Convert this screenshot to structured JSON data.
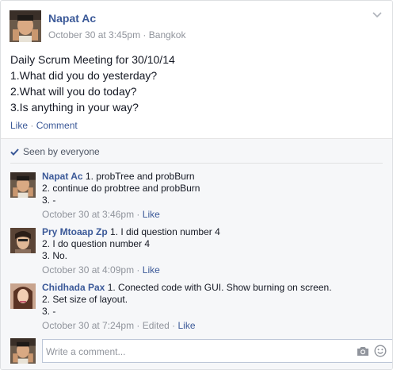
{
  "post": {
    "author": "Napat Ac",
    "date": "October 30 at 3:45pm",
    "separator": "·",
    "location": "Bangkok",
    "lines": [
      "Daily Scrum Meeting for 30/10/14",
      "1.What did you do yesterday?",
      "2.What will you do today?",
      "3.Is anything in your way?"
    ],
    "actions": {
      "like": "Like",
      "comment": "Comment"
    }
  },
  "feedback": {
    "seen": "Seen by everyone",
    "comments": [
      {
        "author": "Napat Ac",
        "first_line": "1. probTree and probBurn",
        "lines": [
          "2. continue do probtree and probBurn",
          "3. -"
        ],
        "time": "October 30 at 3:46pm",
        "edited": "",
        "like": "Like"
      },
      {
        "author": "Pry Mtoaap Zp",
        "first_line": "1. I did question number 4",
        "lines": [
          "2. I do question number 4",
          "3. No."
        ],
        "time": "October 30 at 4:09pm",
        "edited": "",
        "like": "Like"
      },
      {
        "author": "Chidhada Pax",
        "first_line": "1. Conected code with GUI. Show burning on screen.",
        "lines": [
          "2. Set size of layout.",
          "3. -"
        ],
        "time": "October 30 at 7:24pm",
        "edited": "Edited",
        "like": "Like"
      }
    ],
    "composer": {
      "placeholder": "Write a comment..."
    }
  },
  "icons": [
    "chevron-down-icon",
    "checkmark-icon",
    "camera-icon",
    "smiley-icon"
  ],
  "colors": {
    "link": "#3b5998",
    "muted": "#90949c",
    "feedback_bg": "#f6f7f9"
  }
}
